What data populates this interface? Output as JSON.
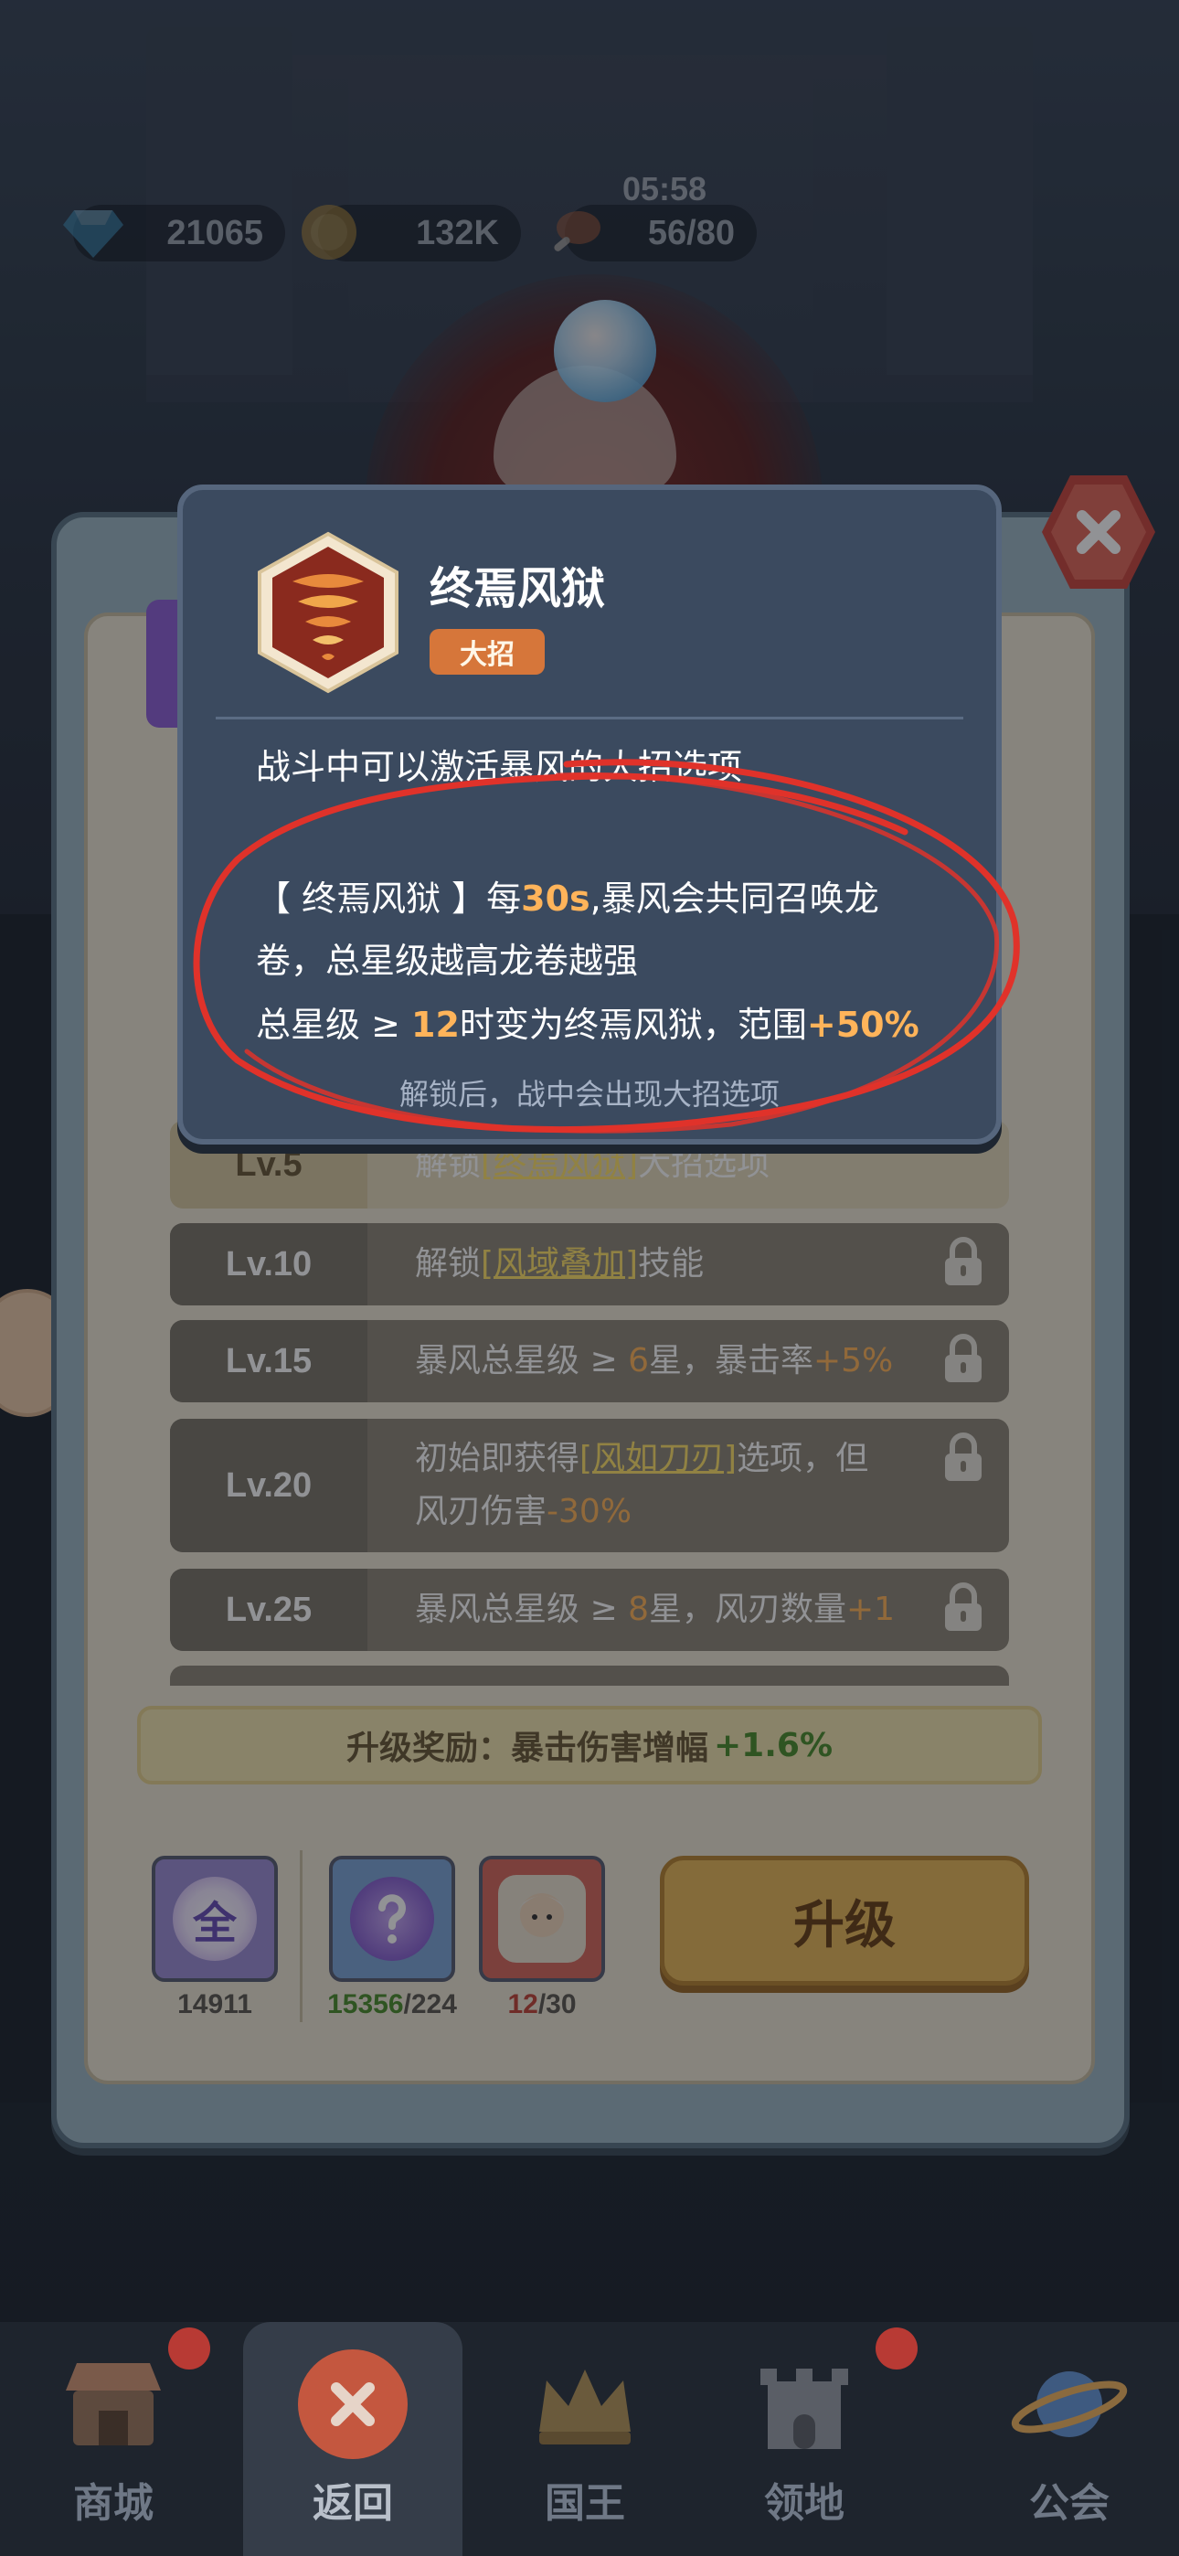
{
  "resources": {
    "gems": "21065",
    "coins": "132K",
    "timer": "05:58",
    "energy": "56/80"
  },
  "popup": {
    "skill_name": "终焉风狱",
    "skill_tag": "大招",
    "line1": "战斗中可以激活暴风的大招选项",
    "line2_pre": "【 终焉风狱 】每",
    "line2_num": "30s",
    "line2_post": ",暴风会共同召唤龙",
    "line3": "卷，总星级越高龙卷越强",
    "line4_pre": "总星级 ≥ ",
    "line4_num": "12",
    "line4_mid": "时变为终焉风狱，范围",
    "line4_num2": "+50%",
    "note": "解锁后，战中会出现大招选项"
  },
  "levels": [
    {
      "level": "Lv.5",
      "pre": "解锁",
      "hl": "[终焉风狱]",
      "post": "大招选项"
    },
    {
      "level": "Lv.10",
      "pre": "解锁",
      "hl": "[风域叠加]",
      "post": "技能"
    },
    {
      "level": "Lv.15",
      "pre": "暴风总星级 ≥ ",
      "num": "6",
      "mid": "星，暴击率",
      "num2": "+5%"
    },
    {
      "level": "Lv.20",
      "pre": "初始即获得",
      "hl": "[风如刀刃]",
      "post": "选项，但",
      "line2": "风刃伤害",
      "num2": "-30%"
    },
    {
      "level": "Lv.25",
      "pre": "暴风总星级 ≥ ",
      "num": "8",
      "mid": "星，风刃数量",
      "num2": "+1"
    }
  ],
  "reward": {
    "label": "升级奖励：暴击伤害增幅",
    "value": "+1.6%"
  },
  "items": {
    "all_glyph": "全",
    "all_count": "14911",
    "question_count_have": "15356",
    "question_count_need": "/224",
    "hero_count_have": "12",
    "hero_count_need": "/30"
  },
  "upgrade_label": "升级",
  "nav": {
    "shop": "商城",
    "back": "返回",
    "king": "国王",
    "territory": "领地",
    "guild": "公会"
  },
  "colors": {
    "accent_orange": "#ffb45a",
    "highlight_yellow": "#ffe26a",
    "reward_green": "#4e8f2e",
    "close_red": "#e0685a",
    "upgrade_gold": "#e8b85a"
  }
}
